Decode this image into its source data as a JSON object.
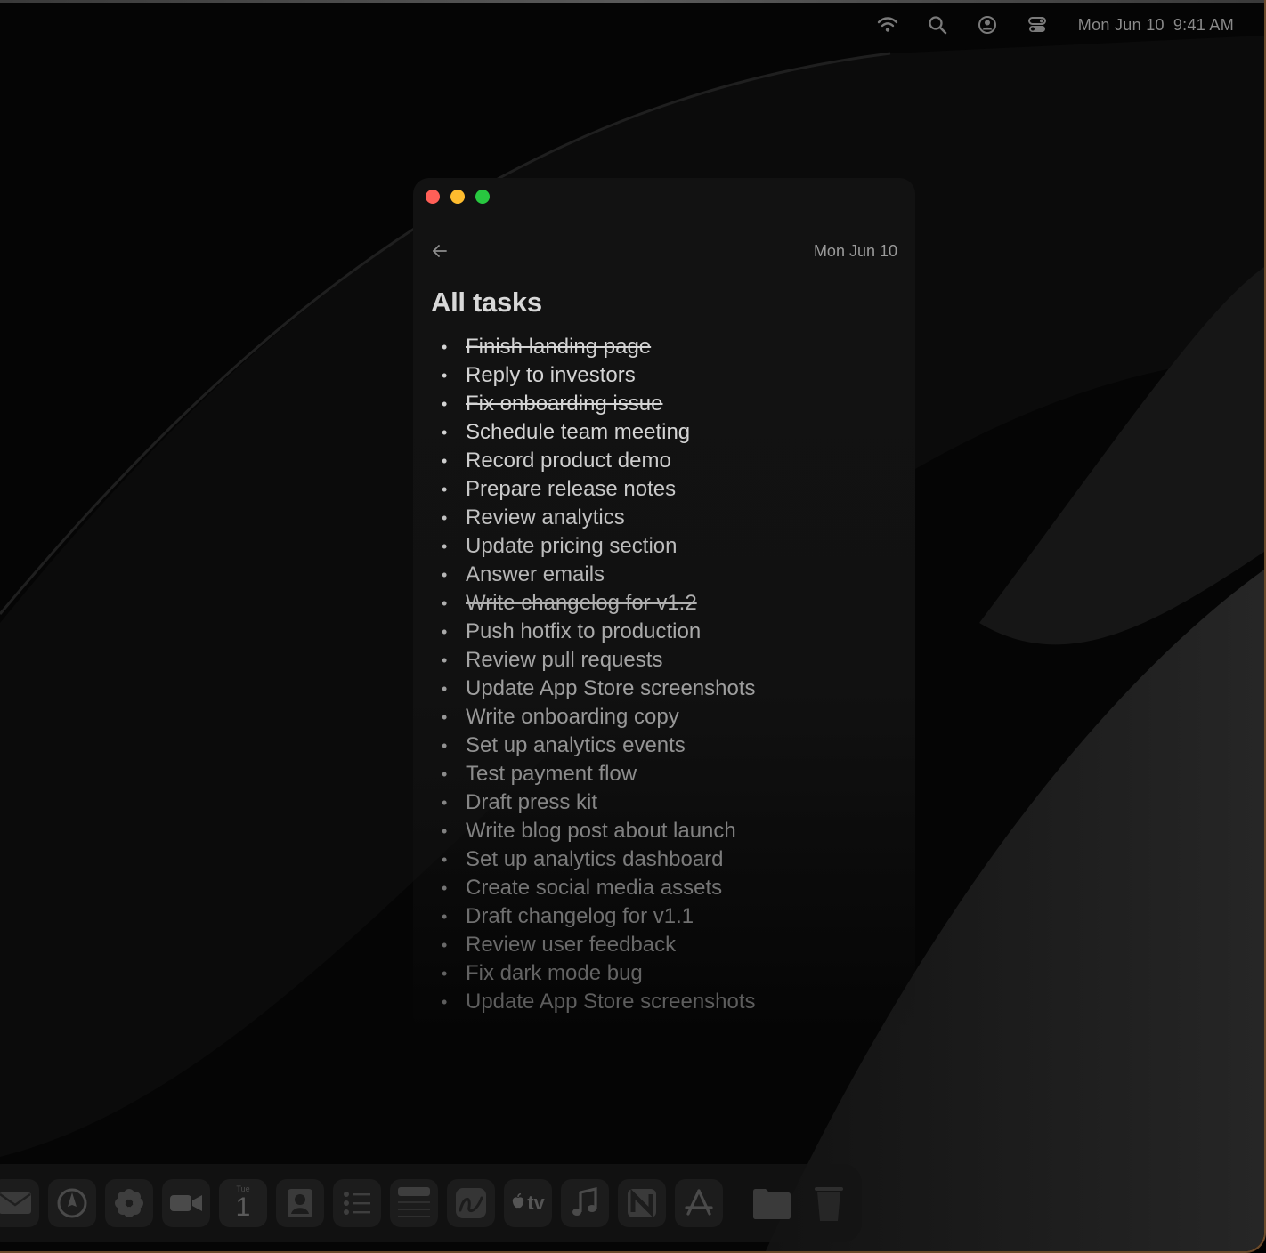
{
  "menubar": {
    "icons": [
      "wifi-icon",
      "search-icon",
      "user-account-icon",
      "control-center-icon"
    ],
    "date": "Mon Jun 10",
    "time": "9:41 AM"
  },
  "window": {
    "date_label": "Mon Jun 10",
    "title": "All tasks",
    "tasks": [
      {
        "text": "Finish landing page",
        "done": true
      },
      {
        "text": "Reply to investors",
        "done": false
      },
      {
        "text": "Fix onboarding issue",
        "done": true
      },
      {
        "text": "Schedule team meeting",
        "done": false
      },
      {
        "text": "Record product demo",
        "done": false
      },
      {
        "text": "Prepare release notes",
        "done": false
      },
      {
        "text": "Review analytics",
        "done": false
      },
      {
        "text": "Update pricing section",
        "done": false
      },
      {
        "text": "Answer emails",
        "done": false
      },
      {
        "text": "Write changelog for v1.2",
        "done": true
      },
      {
        "text": "Push hotfix to production",
        "done": false
      },
      {
        "text": "Review pull requests",
        "done": false
      },
      {
        "text": "Update App Store screenshots",
        "done": false
      },
      {
        "text": "Write onboarding copy",
        "done": false
      },
      {
        "text": "Set up analytics events",
        "done": false
      },
      {
        "text": "Test payment flow",
        "done": false
      },
      {
        "text": "Draft press kit",
        "done": false
      },
      {
        "text": "Write blog post about launch",
        "done": false
      },
      {
        "text": "Set up analytics dashboard",
        "done": false
      },
      {
        "text": "Create social media assets",
        "done": false
      },
      {
        "text": "Draft changelog for v1.1",
        "done": false
      },
      {
        "text": "Review user feedback",
        "done": false
      },
      {
        "text": "Fix dark mode bug",
        "done": false
      },
      {
        "text": "Update App Store screenshots",
        "done": false
      }
    ]
  },
  "dock": {
    "apps": [
      {
        "name": "mail-icon"
      },
      {
        "name": "safari-icon"
      },
      {
        "name": "photos-icon"
      },
      {
        "name": "facetime-icon"
      },
      {
        "name": "calendar-icon",
        "weekday": "Tue",
        "day": "1"
      },
      {
        "name": "contacts-icon"
      },
      {
        "name": "reminders-icon"
      },
      {
        "name": "notes-icon"
      },
      {
        "name": "freeform-icon"
      },
      {
        "name": "appletv-icon",
        "label": "tv"
      },
      {
        "name": "music-icon"
      },
      {
        "name": "news-icon"
      },
      {
        "name": "appstore-icon"
      },
      {
        "name": "folder-icon"
      },
      {
        "name": "trash-icon"
      }
    ]
  }
}
